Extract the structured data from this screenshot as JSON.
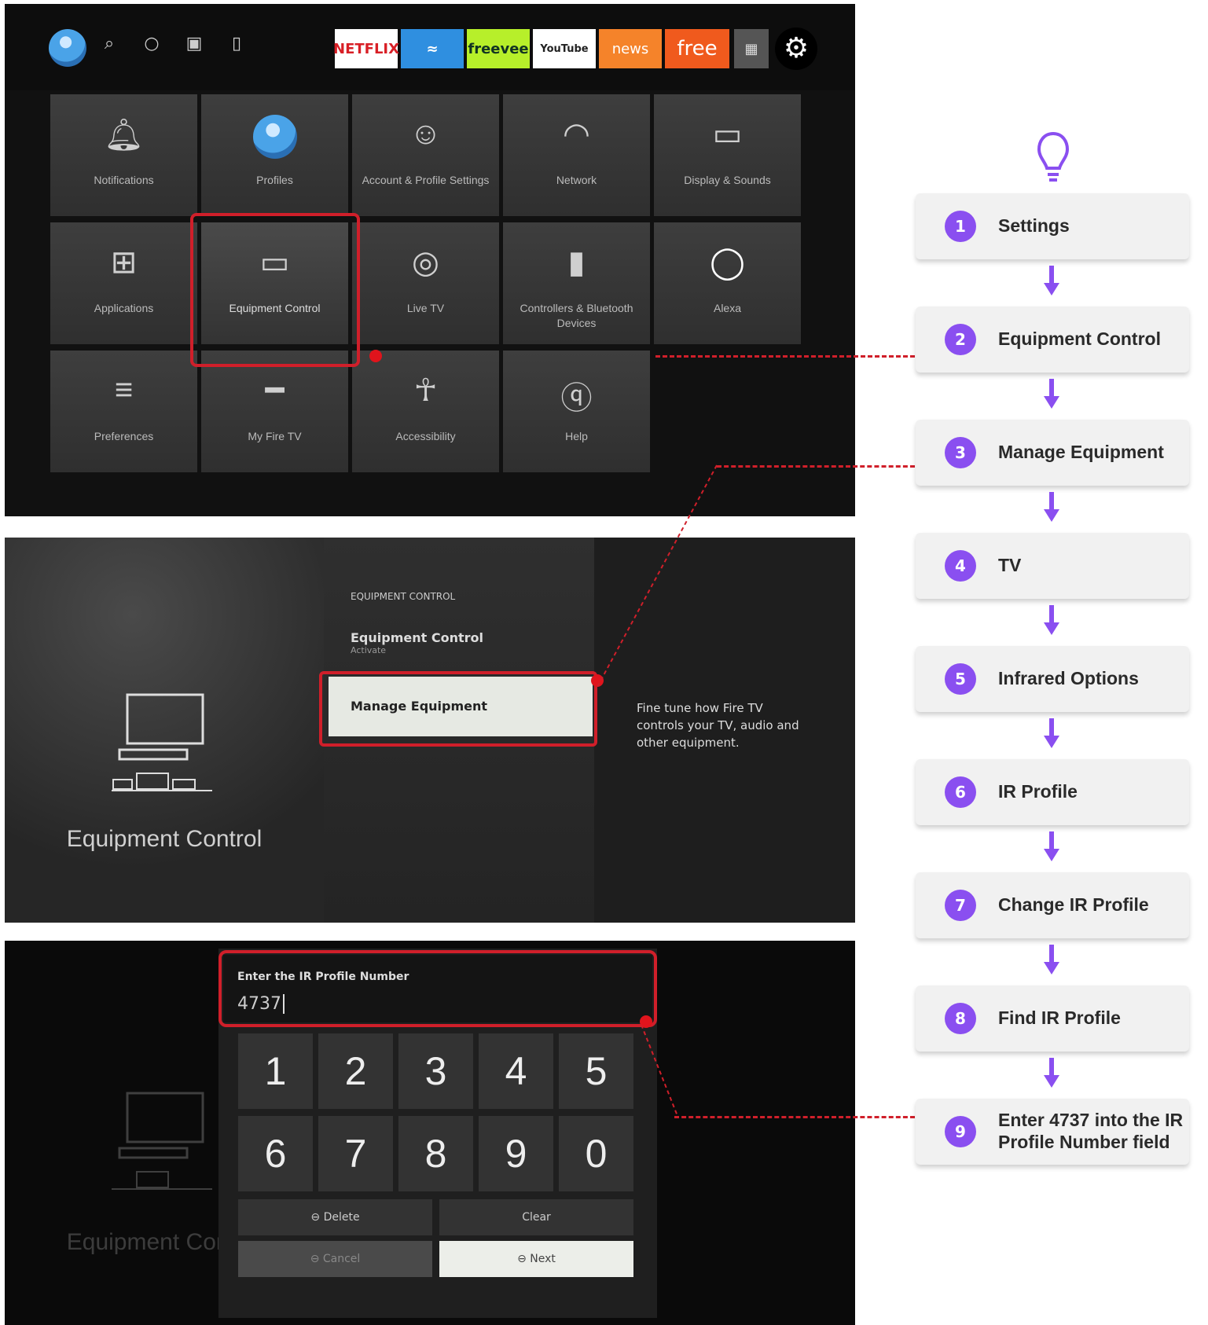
{
  "fire_tv_home": {
    "app_tiles": [
      "NETFLIX",
      "freevee",
      "YouTube",
      "news",
      "free"
    ],
    "settings_tiles": [
      "Notifications",
      "Profiles",
      "Account & Profile Settings",
      "Network",
      "Display & Sounds",
      "Applications",
      "Equipment Control",
      "Live TV",
      "Controllers & Bluetooth Devices",
      "Alexa",
      "Preferences",
      "My Fire TV",
      "Accessibility",
      "Help"
    ]
  },
  "equipment_screen": {
    "title": "Equipment Control",
    "section_label": "EQUIPMENT CONTROL",
    "item_title": "Equipment Control",
    "item_sub": "Activate",
    "selected_item": "Manage Equipment",
    "description": "Fine tune how Fire TV controls your TV, audio and other equipment."
  },
  "ir_screen": {
    "input_label": "Enter the IR Profile Number",
    "input_value": "4737",
    "keys": [
      "1",
      "2",
      "3",
      "4",
      "5",
      "6",
      "7",
      "8",
      "9",
      "0"
    ],
    "delete": "Delete",
    "clear": "Clear",
    "cancel": "Cancel",
    "next": "Next",
    "bg_title": "Equipment Control"
  },
  "steps": [
    {
      "num": "1",
      "label": "Settings"
    },
    {
      "num": "2",
      "label": "Equipment Control"
    },
    {
      "num": "3",
      "label": "Manage Equipment"
    },
    {
      "num": "4",
      "label": "TV"
    },
    {
      "num": "5",
      "label": "Infrared Options"
    },
    {
      "num": "6",
      "label": "IR Profile"
    },
    {
      "num": "7",
      "label": "Change IR Profile"
    },
    {
      "num": "8",
      "label": "Find IR Profile"
    },
    {
      "num": "9",
      "label": "Enter 4737 into the IR Profile Number field"
    }
  ],
  "colors": {
    "accent": "#8a4ff0",
    "highlight": "#d01f2a"
  }
}
